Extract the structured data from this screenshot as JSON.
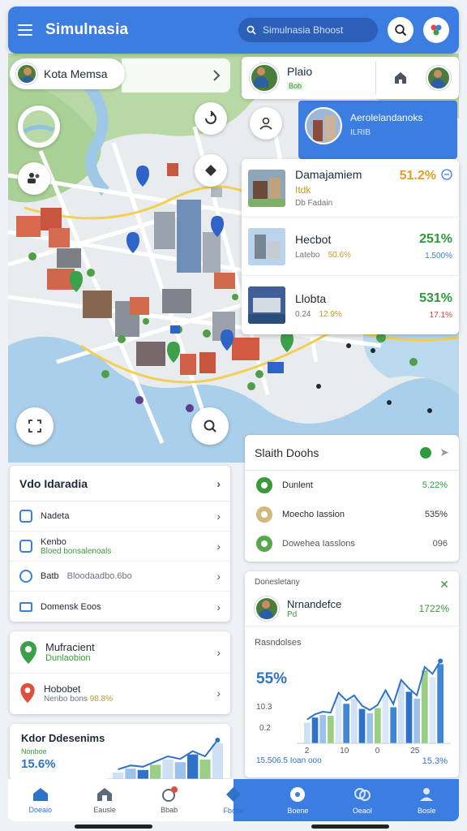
{
  "header": {
    "app_title": "Simulnasia",
    "search_placeholder": "Simulnasia Bhoost"
  },
  "city_chip": {
    "label": "Kota Memsa"
  },
  "profile_card": {
    "name": "Plaio",
    "sub": "Bob"
  },
  "info_card": {
    "title": "Aerolelandanoks",
    "subtitle": "ILRIB"
  },
  "places": [
    {
      "title": "Damajamiem",
      "tag": "Itdk",
      "sub": "Db Fadain",
      "value": "51.2%",
      "value_color": "#e0a020"
    },
    {
      "title": "Hecbot",
      "sub": "Latebo",
      "stat1": "50.6%",
      "value": "251%",
      "value2": "1.500%",
      "value_color": "#2f9a3d"
    },
    {
      "title": "Llobta",
      "sub": "0.24",
      "stat1": "12.9%",
      "value": "531%",
      "value2": "17.1%",
      "value_color": "#2f9a3d",
      "value2_color": "#d64040"
    }
  ],
  "video_panel": {
    "title": "Vdo Idaradia",
    "rows": [
      {
        "label": "Nadeta"
      },
      {
        "label": "Kenbo",
        "sub": "Bloed bonsalenoals"
      },
      {
        "label": "Batb",
        "sub": "Bloodaadbo.6bo"
      },
      {
        "label": "Domensk Eoos"
      }
    ]
  },
  "poi_panel": {
    "rows": [
      {
        "label": "Mufracient",
        "sub": "Dunlaobion"
      },
      {
        "label": "Hobobet",
        "sub": "Nenbo bons",
        "sub_value": "98.8%"
      }
    ]
  },
  "kdor_panel": {
    "title": "Kdor Ddesenims",
    "caption": "Nonboe",
    "value": "15.6%"
  },
  "stats_panel": {
    "title": "Slaith Doohs",
    "rows": [
      {
        "label": "Dunlent",
        "value": "5.22%",
        "value_color": "#2f9a3d",
        "dot": "#3a9a3a"
      },
      {
        "label": "Moecho Iassion",
        "value": "535%",
        "value_color": "#333333",
        "dot": "#d2b87a"
      },
      {
        "label": "Dowehea Iasslons",
        "value": "096",
        "value_color": "#555555",
        "dot": "#57a84b"
      }
    ]
  },
  "growth_panel": {
    "head_label": "Donesletany",
    "name": "Nrnandefce",
    "sub": "Pd",
    "value": "1722%",
    "chart_title": "Rasndolses",
    "big_value": "55%",
    "tick1": "10.3",
    "tick2": "0.2",
    "x_ticks": [
      "2",
      "10",
      "0",
      "25"
    ],
    "footer_left": "15.506.5 Ioan ooo",
    "footer_right": "15.3%"
  },
  "nav": {
    "items": [
      "Doeaio",
      "Eausle",
      "Bbab",
      "Fbolte",
      "Boene",
      "Oeaol",
      "Bosle"
    ]
  },
  "chart_data": [
    {
      "type": "bar",
      "title": "Rasndolses",
      "categories": [
        "1",
        "2",
        "3",
        "4",
        "5",
        "6",
        "7",
        "8",
        "9",
        "10",
        "11",
        "12",
        "13",
        "14",
        "15",
        "16",
        "17",
        "18"
      ],
      "series": [
        {
          "values": [
            24,
            30,
            33,
            32,
            55,
            46,
            52,
            40,
            35,
            41,
            58,
            42,
            70,
            60,
            52,
            85,
            77,
            92
          ]
        }
      ],
      "ylim": [
        0,
        100
      ]
    },
    {
      "type": "bar",
      "title": "Kdor Ddesenims",
      "categories": [
        "1",
        "2",
        "3",
        "4",
        "5",
        "6",
        "7",
        "8",
        "9"
      ],
      "series": [
        {
          "values": [
            10,
            16,
            14,
            22,
            30,
            26,
            38,
            30,
            55
          ]
        }
      ],
      "ylim": [
        0,
        60
      ]
    }
  ]
}
